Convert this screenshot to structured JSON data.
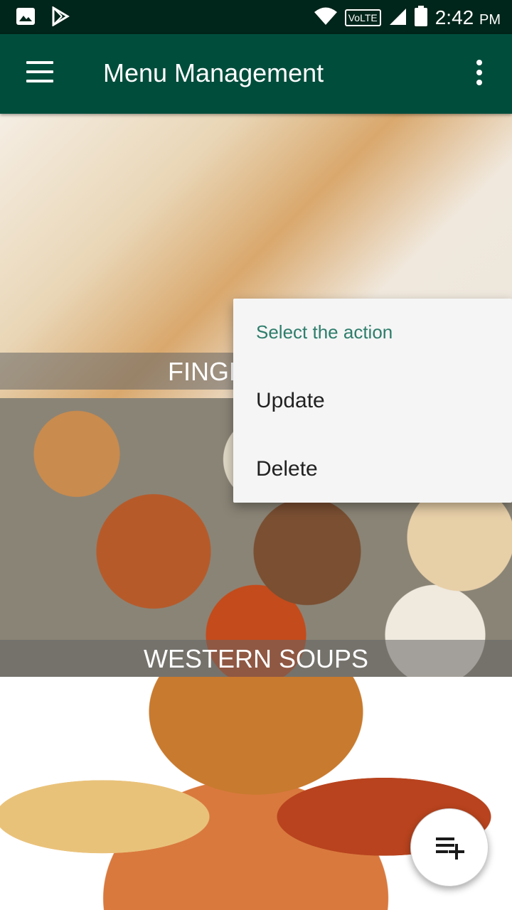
{
  "status_bar": {
    "time": "2:42",
    "ampm": "PM",
    "network_label": "VoLTE",
    "icons": [
      "image-icon",
      "play-store-icon",
      "wifi-icon",
      "signal-icon",
      "battery-icon"
    ]
  },
  "app_bar": {
    "title": "Menu Management",
    "icons": [
      "hamburger-menu-icon",
      "overflow-menu-icon"
    ]
  },
  "categories": [
    {
      "label": "FINGE"
    },
    {
      "label": "WESTERN SOUPS"
    },
    {
      "label": ""
    }
  ],
  "action_popup": {
    "title": "Select the action",
    "options": [
      "Update",
      "Delete"
    ]
  },
  "fab": {
    "icon": "playlist-add-icon"
  },
  "colors": {
    "status_bar": "#00251a",
    "app_bar": "#004d3c",
    "popup_title": "#2e7d6b",
    "popup_bg": "#f5f5f5"
  }
}
